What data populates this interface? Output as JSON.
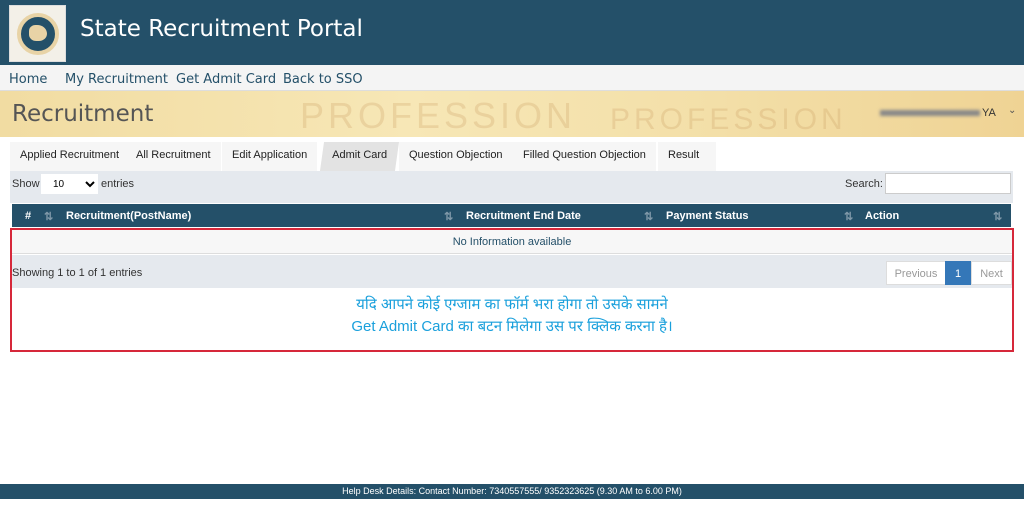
{
  "header": {
    "title": "State Recruitment Portal",
    "logo_text": "Rajasthan"
  },
  "nav": [
    "Home",
    "My Recruitment",
    "Get Admit Card",
    "Back to SSO"
  ],
  "banner": {
    "title": "Recruitment",
    "watermark": "PROFESSION",
    "user_visible": "YA"
  },
  "tabs": [
    "Applied Recruitment",
    "All Recruitment",
    "Edit Application",
    "Admit Card",
    "Question Objection",
    "Filled Question Objection",
    "Result"
  ],
  "active_tab": "Admit Card",
  "table": {
    "show_label": "Show",
    "entries_value": "10",
    "entries_label": "entries",
    "search_label": "Search:",
    "search_value": "",
    "columns": [
      "#",
      "Recruitment(PostName)",
      "Recruitment End Date",
      "Payment Status",
      "Action"
    ],
    "empty": "No Information available",
    "info": "Showing 1 to 1 of 1 entries",
    "pagination": {
      "previous": "Previous",
      "current": "1",
      "next": "Next"
    }
  },
  "note": {
    "line1": "यदि आपने कोई एग्जाम का फॉर्म भरा होगा तो उसके सामने",
    "line2": "Get Admit Card का बटन मिलेगा उस पर क्लिक करना है।"
  },
  "footer": "Help Desk Details: Contact Number: 7340557555/ 9352323625 (9.30 AM to 6.00 PM)",
  "colors": {
    "primary": "#245069",
    "highlight": "#d6283a",
    "note": "#1aa0dc",
    "page_active": "#3477b8"
  }
}
